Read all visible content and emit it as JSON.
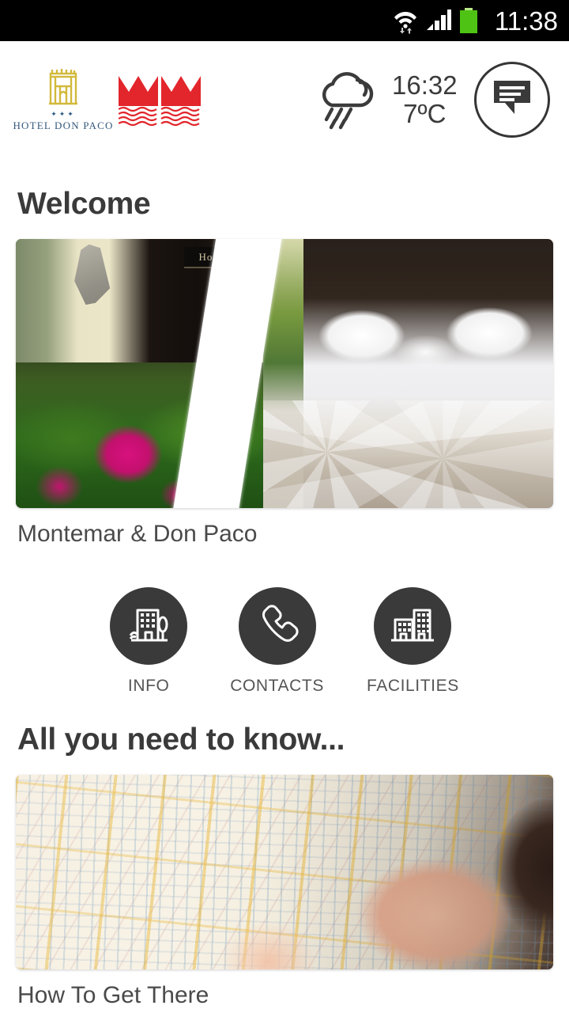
{
  "status_bar": {
    "time": "11:38",
    "icons": [
      "wifi-icon",
      "cellular-signal-icon",
      "battery-icon"
    ],
    "battery_color": "#4fc314"
  },
  "header": {
    "logo_primary": {
      "name": "HOTEL DON PACO",
      "stars": "✦✦✦",
      "icon": "hotel-gate-icon",
      "gold": "#d2b93b",
      "text_color": "#34597c"
    },
    "logo_secondary": {
      "name": "montemar-mm-logo",
      "color": "#e2262c"
    },
    "weather": {
      "icon": "rain-cloud-sun-icon",
      "time": "16:32",
      "temperature": "7ºC"
    },
    "chat_button": {
      "label": "chat",
      "icon": "chat-bubble-icon"
    }
  },
  "main": {
    "sections": [
      {
        "title": "Welcome",
        "card": {
          "image_alt": "hotel-terrace-and-bedroom-split",
          "caption": "Montemar & Don Paco"
        }
      },
      {
        "title": "All you need to know...",
        "card": {
          "image_alt": "hands-holding-paper-map",
          "caption": "How To Get There"
        }
      }
    ],
    "actions": [
      {
        "label": "INFO",
        "icon": "hotel-building-icon"
      },
      {
        "label": "CONTACTS",
        "icon": "phone-handset-icon"
      },
      {
        "label": "FACILITIES",
        "icon": "buildings-icon"
      }
    ]
  },
  "colors": {
    "accent_red": "#e2262c",
    "accent_gold": "#d2b93b",
    "text_dark": "#3a3a3a",
    "circle_bg": "#3a3a3a"
  }
}
